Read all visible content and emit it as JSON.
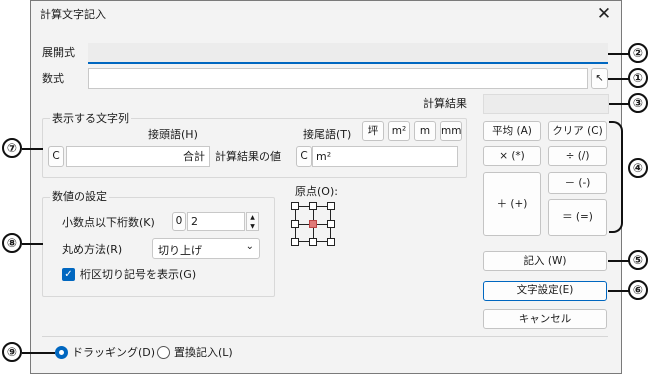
{
  "window": {
    "title": "計算文字記入"
  },
  "fields": {
    "expansion_label": "展開式",
    "formula_label": "数式",
    "calc_result_label": "計算結果"
  },
  "display_group": {
    "legend": "表示する文字列",
    "prefix_label": "接頭語(H)",
    "suffix_label": "接尾語(T)",
    "prefix_c": "C",
    "prefix_value": "合計",
    "middle_label": "計算結果の値",
    "suffix_c": "C",
    "suffix_value": "m²",
    "unit_buttons": [
      "坪",
      "m²",
      "m",
      "mm"
    ]
  },
  "numeric_group": {
    "legend": "数値の設定",
    "decimals_label": "小数点以下桁数(K)",
    "decimals_prefix": "0",
    "decimals_value": "2",
    "rounding_label": "丸め方法(R)",
    "rounding_value": "切り上げ",
    "separator_label": "桁区切り記号を表示(G)",
    "separator_checked": true
  },
  "origin": {
    "label": "原点(O):"
  },
  "op_buttons": {
    "average": "平均 (A)",
    "clear": "クリア (C)",
    "multiply": "× (*)",
    "divide": "÷ (/)",
    "minus": "－ (-)",
    "plus": "＋ (+)",
    "equals": "＝ (=)"
  },
  "action_buttons": {
    "enter": "記入 (W)",
    "text_settings": "文字設定(E)",
    "cancel": "キャンセル"
  },
  "mode": {
    "drag_label": "ドラッギング(D)",
    "replace_label": "置換記入(L)",
    "selected": "drag"
  },
  "callouts": [
    "①",
    "②",
    "③",
    "④",
    "⑤",
    "⑥",
    "⑦",
    "⑧",
    "⑨"
  ],
  "colors": {
    "accent": "#0067c0",
    "callout": "#111111",
    "origin_selected": "#e07a78"
  },
  "icons": {
    "close": "close-icon",
    "pick": "cursor-arrow-icon",
    "dropdown": "chevron-down-icon"
  }
}
